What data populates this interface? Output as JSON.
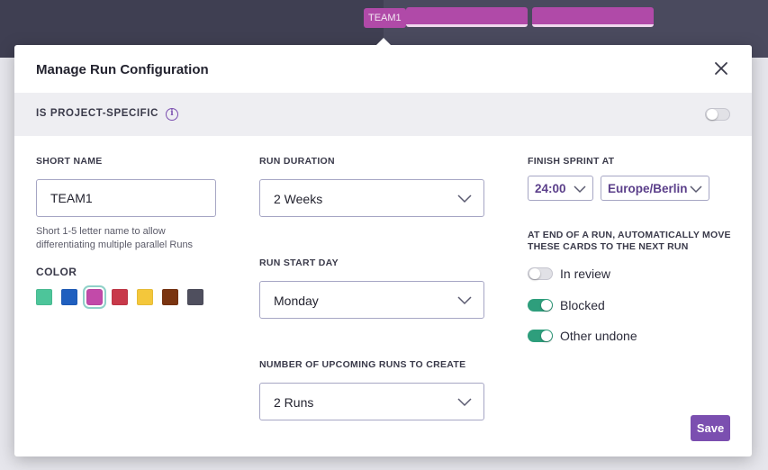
{
  "background": {
    "team_tag": "TEAM1"
  },
  "modal": {
    "title": "Manage Run Configuration",
    "project_specific": {
      "label": "IS PROJECT-SPECIFIC",
      "enabled": false
    },
    "short_name": {
      "label": "SHORT NAME",
      "value": "TEAM1",
      "help": "Short 1-5 letter name to allow differentiating multiple parallel Runs"
    },
    "color": {
      "label": "COLOR",
      "swatches": [
        "#4dc59a",
        "#1f5fbf",
        "#c24aa9",
        "#c8394a",
        "#f4c73b",
        "#7a3410",
        "#4f4f5e"
      ],
      "selected": "#c24aa9"
    },
    "run_duration": {
      "label": "RUN DURATION",
      "value": "2 Weeks"
    },
    "run_start_day": {
      "label": "RUN START DAY",
      "value": "Monday"
    },
    "upcoming_runs": {
      "label": "NUMBER OF UPCOMING RUNS TO CREATE",
      "value": "2 Runs"
    },
    "finish_sprint": {
      "label": "FINISH SPRINT AT",
      "time": "24:00",
      "timezone": "Europe/Berlin"
    },
    "auto_move": {
      "label": "AT END OF A RUN, AUTOMATICALLY MOVE THESE CARDS TO THE NEXT RUN",
      "options": [
        {
          "label": "In review",
          "enabled": false
        },
        {
          "label": "Blocked",
          "enabled": true
        },
        {
          "label": "Other undone",
          "enabled": true
        }
      ]
    },
    "save_label": "Save"
  },
  "colors": {
    "accent": "#7b4fb0",
    "toggle_on": "#2e9e7c"
  }
}
